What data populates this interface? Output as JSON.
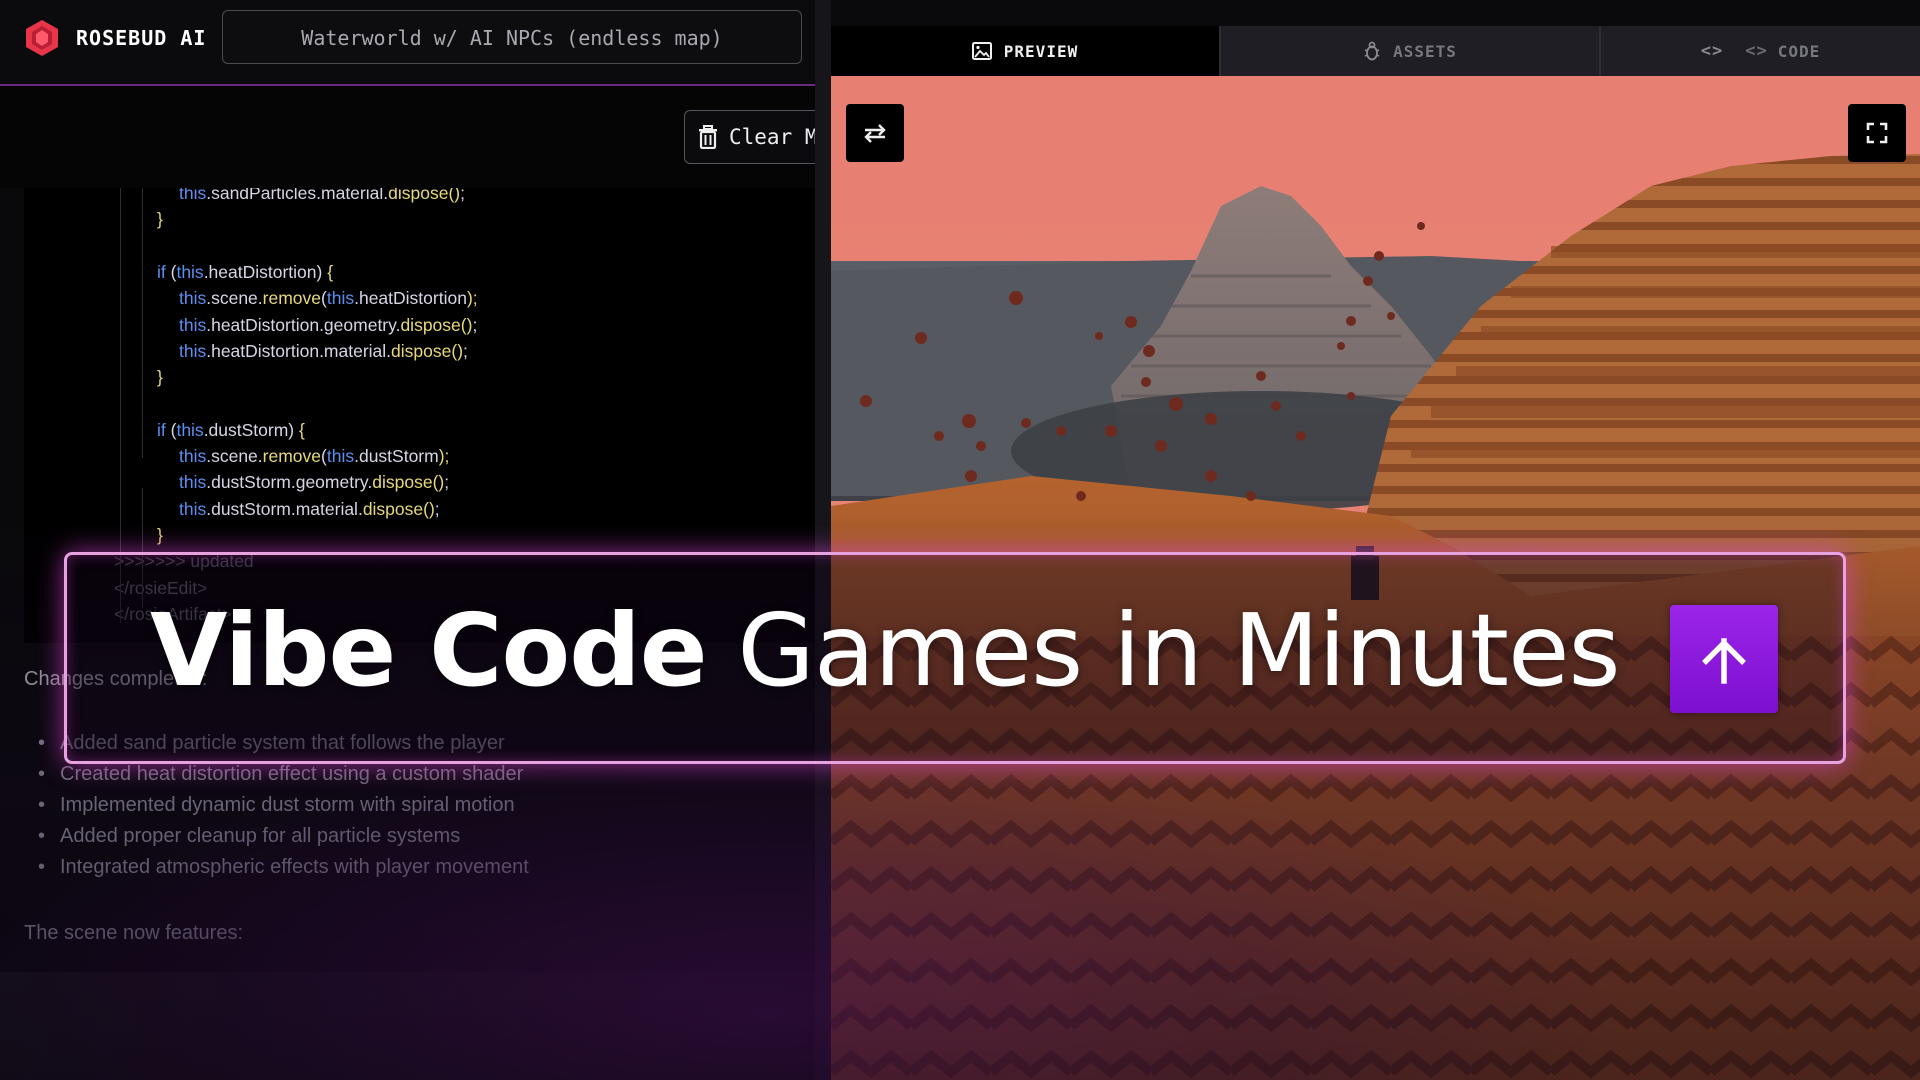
{
  "app": {
    "brand": "ROSEBUD AI",
    "project_title": "Waterworld w/ AI NPCs (endless map)"
  },
  "toolbar": {
    "clear_label": "Clear M"
  },
  "code_lines": [
    {
      "indent": 2,
      "text": "this.sandParticles.material.dispose();"
    },
    {
      "indent": 1,
      "text": "}"
    },
    {
      "indent": 1,
      "text": ""
    },
    {
      "indent": 1,
      "text": "if (this.heatDistortion) {"
    },
    {
      "indent": 2,
      "text": "this.scene.remove(this.heatDistortion);"
    },
    {
      "indent": 2,
      "text": "this.heatDistortion.geometry.dispose();"
    },
    {
      "indent": 2,
      "text": "this.heatDistortion.material.dispose();"
    },
    {
      "indent": 1,
      "text": "}"
    },
    {
      "indent": 1,
      "text": ""
    },
    {
      "indent": 1,
      "text": "if (this.dustStorm) {"
    },
    {
      "indent": 2,
      "text": "this.scene.remove(this.dustStorm);"
    },
    {
      "indent": 2,
      "text": "this.dustStorm.geometry.dispose();"
    },
    {
      "indent": 2,
      "text": "this.dustStorm.material.dispose();"
    },
    {
      "indent": 1,
      "text": "}"
    },
    {
      "indent": 0,
      "text": ">>>>>>> updated"
    },
    {
      "indent": 0,
      "text": "</rosieEdit>"
    },
    {
      "indent": 0,
      "text": "</rosieArtifact>"
    }
  ],
  "chat": {
    "changes_title": "Changes completed:",
    "bullets": [
      "Added sand particle system that follows the player",
      "Created heat distortion effect using a custom shader",
      "Implemented dynamic dust storm with spiral motion",
      "Added proper cleanup for all particle systems",
      "Integrated atmospheric effects with player movement"
    ],
    "scene_text": "The scene now features:"
  },
  "tabs": [
    {
      "label": "PREVIEW",
      "icon": "image-icon",
      "active": true
    },
    {
      "label": "ASSETS",
      "icon": "bug-icon",
      "active": false
    },
    {
      "label": "CODE",
      "icon": "code-icon",
      "active": false
    }
  ],
  "headline": {
    "bold": "Vibe Code",
    "light": "Games in Minutes",
    "separator": "|"
  },
  "colors": {
    "accent": "#8e1ae0",
    "glow": "#e8a2e0",
    "sky": "#e87f72",
    "terrain": "#a8582d"
  }
}
